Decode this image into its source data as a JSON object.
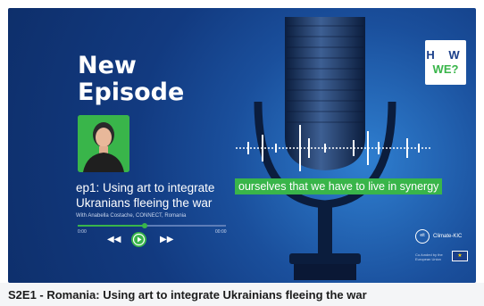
{
  "poster": {
    "headline": "New\nEpisode",
    "episode_title": "ep1: Using art to integrate Ukranians fleeing the war",
    "credit": "With Anabella Costache, CONNECT, Romania",
    "time_elapsed": "0:00",
    "time_total": "00:00",
    "progress": 0.45,
    "subtitle": "ourselves that we have to live in synergy",
    "logo_top": "H W",
    "logo_bottom": "WE?",
    "partner_name": "Climate-KIC",
    "partner_badge": "eit",
    "eu_note": "Co-funded by the European Union",
    "colors": {
      "accent": "#39b54a",
      "background": "#1a4f9c",
      "text": "#ffffff"
    }
  },
  "icons": {
    "rewind": "rewind-icon",
    "play": "play-icon",
    "forward": "forward-icon",
    "mic": "microphone-icon",
    "eu": "eu-flag-icon"
  },
  "caption": "S2E1 - Romania: Using art to integrate Ukrainians fleeing the war"
}
